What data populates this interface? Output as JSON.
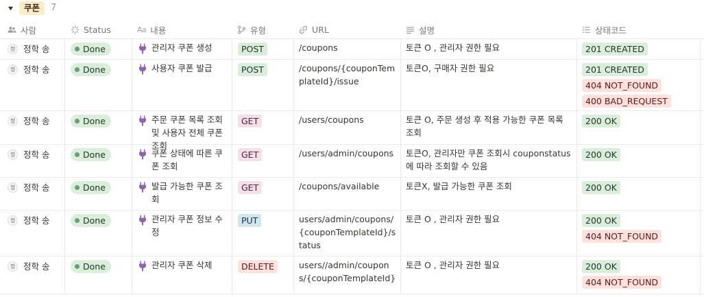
{
  "group": {
    "toggle_icon": "triangle-down-icon",
    "label": "쿠폰",
    "count": "7"
  },
  "columns": {
    "person": {
      "label": "사람",
      "icon": "people-icon"
    },
    "status": {
      "label": "Status",
      "icon": "status-spinner-icon"
    },
    "content": {
      "label": "내용",
      "icon": "text-aa-icon",
      "prefix": "Aa"
    },
    "type": {
      "label": "유형",
      "icon": "branch-icon"
    },
    "url": {
      "label": "URL",
      "icon": "link-icon"
    },
    "description": {
      "label": "설명",
      "icon": "text-lines-icon"
    },
    "status_code": {
      "label": "상태코드",
      "icon": "list-icon"
    }
  },
  "colors": {
    "POST": {
      "bg": "#dbeddb",
      "fg": "#1c3829"
    },
    "GET": {
      "bg": "#f5e0e9",
      "fg": "#4c2337"
    },
    "PUT": {
      "bg": "#d3e5ef",
      "fg": "#183347"
    },
    "DELETE": {
      "bg": "#ffe2dd",
      "fg": "#5d1715"
    },
    "ok": {
      "bg": "#dbeddb",
      "fg": "#1c3829"
    },
    "err": {
      "bg": "#ffe2dd",
      "fg": "#5d1715"
    }
  },
  "rows": [
    {
      "avatar": "정",
      "person": "정학 송",
      "status": "Done",
      "content_icon": "plug-icon",
      "content": "관리자 쿠폰 생성",
      "type": "POST",
      "url": "/coupons",
      "description": "토큰 O , 관리자 권한 필요",
      "codes": [
        {
          "text": "201 CREATED",
          "kind": "ok"
        }
      ]
    },
    {
      "avatar": "정",
      "person": "정학 송",
      "status": "Done",
      "content_icon": "plug-icon",
      "content": "사용자 쿠폰 발급",
      "type": "POST",
      "url": "/coupons/{couponTemplateId}/issue",
      "description": "토큰O,  구매자 권한 필요",
      "codes": [
        {
          "text": "201 CREATED",
          "kind": "ok"
        },
        {
          "text": "404 NOT_FOUND",
          "kind": "err"
        },
        {
          "text": "400 BAD_REQUEST",
          "kind": "err"
        }
      ]
    },
    {
      "avatar": "정",
      "person": "정학 송",
      "status": "Done",
      "content_icon": "plug-icon",
      "content": "주문 쿠폰 목록 조회 및 사용자 전체 쿠폰 조회",
      "type": "GET",
      "url": "/users/coupons",
      "description": "토큰 O, 주문 생성 후 적용 가능한 쿠폰 목록 조회",
      "codes": [
        {
          "text": "200 OK",
          "kind": "ok"
        }
      ]
    },
    {
      "avatar": "정",
      "person": "정학 송",
      "status": "Done",
      "content_icon": "plug-icon",
      "content": "쿠폰 상태에 따른 쿠폰 조회",
      "type": "GET",
      "url": "/users/admin/coupons",
      "description": "토큰O,  관리자만 쿠폰 조회시 couponstatus에 따라 조회할 수 있음",
      "codes": [
        {
          "text": "200 OK",
          "kind": "ok"
        }
      ]
    },
    {
      "avatar": "정",
      "person": "정학 송",
      "status": "Done",
      "content_icon": "plug-icon",
      "content": "발급 가능한 쿠폰 조회",
      "type": "GET",
      "url": "/coupons/available",
      "description": "토큰X, 발급 가능한 쿠폰 조회",
      "codes": [
        {
          "text": "200 OK",
          "kind": "ok"
        }
      ]
    },
    {
      "avatar": "정",
      "person": "정학 송",
      "status": "Done",
      "content_icon": "plug-icon",
      "content": "관리자 쿠폰 정보 수정",
      "type": "PUT",
      "url": "users/admin/coupons/{couponTemplateId}/status",
      "description": "토큰 O , 관리자 권한 필요",
      "codes": [
        {
          "text": "200 OK",
          "kind": "ok"
        },
        {
          "text": "404 NOT_FOUND",
          "kind": "err"
        }
      ]
    },
    {
      "avatar": "정",
      "person": "정학 송",
      "status": "Done",
      "content_icon": "plug-icon",
      "content": "관리자 쿠폰 삭제",
      "type": "DELETE",
      "url": "users//admin/coupons/{couponTemplateId}",
      "description": "토큰 O , 관리자 권한 필요",
      "codes": [
        {
          "text": "200 OK",
          "kind": "ok"
        },
        {
          "text": "404 NOT_FOUND",
          "kind": "err"
        }
      ]
    }
  ]
}
